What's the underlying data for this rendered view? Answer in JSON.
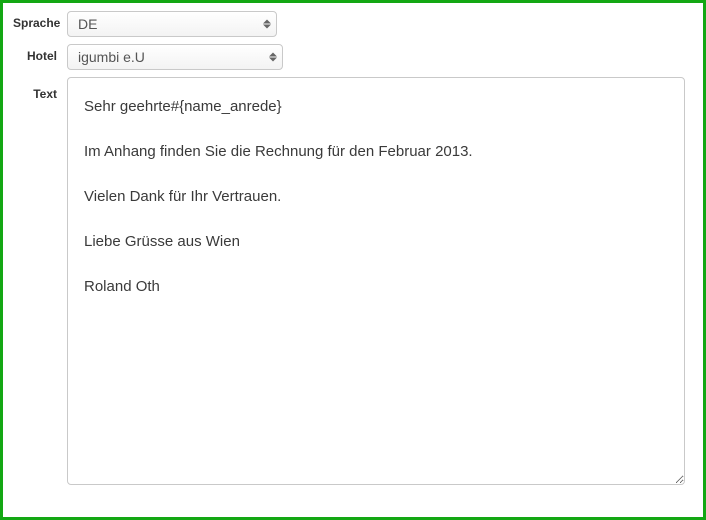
{
  "labels": {
    "sprache": "Sprache",
    "hotel": "Hotel",
    "text": "Text"
  },
  "fields": {
    "sprache": {
      "selected": "DE"
    },
    "hotel": {
      "selected": "igumbi e.U"
    },
    "text": {
      "value": "Sehr geehrte#{name_anrede}\n\nIm Anhang finden Sie die Rechnung für den Februar 2013.\n\nVielen Dank für Ihr Vertrauen.\n\nLiebe Grüsse aus Wien\n\nRoland Oth"
    }
  }
}
